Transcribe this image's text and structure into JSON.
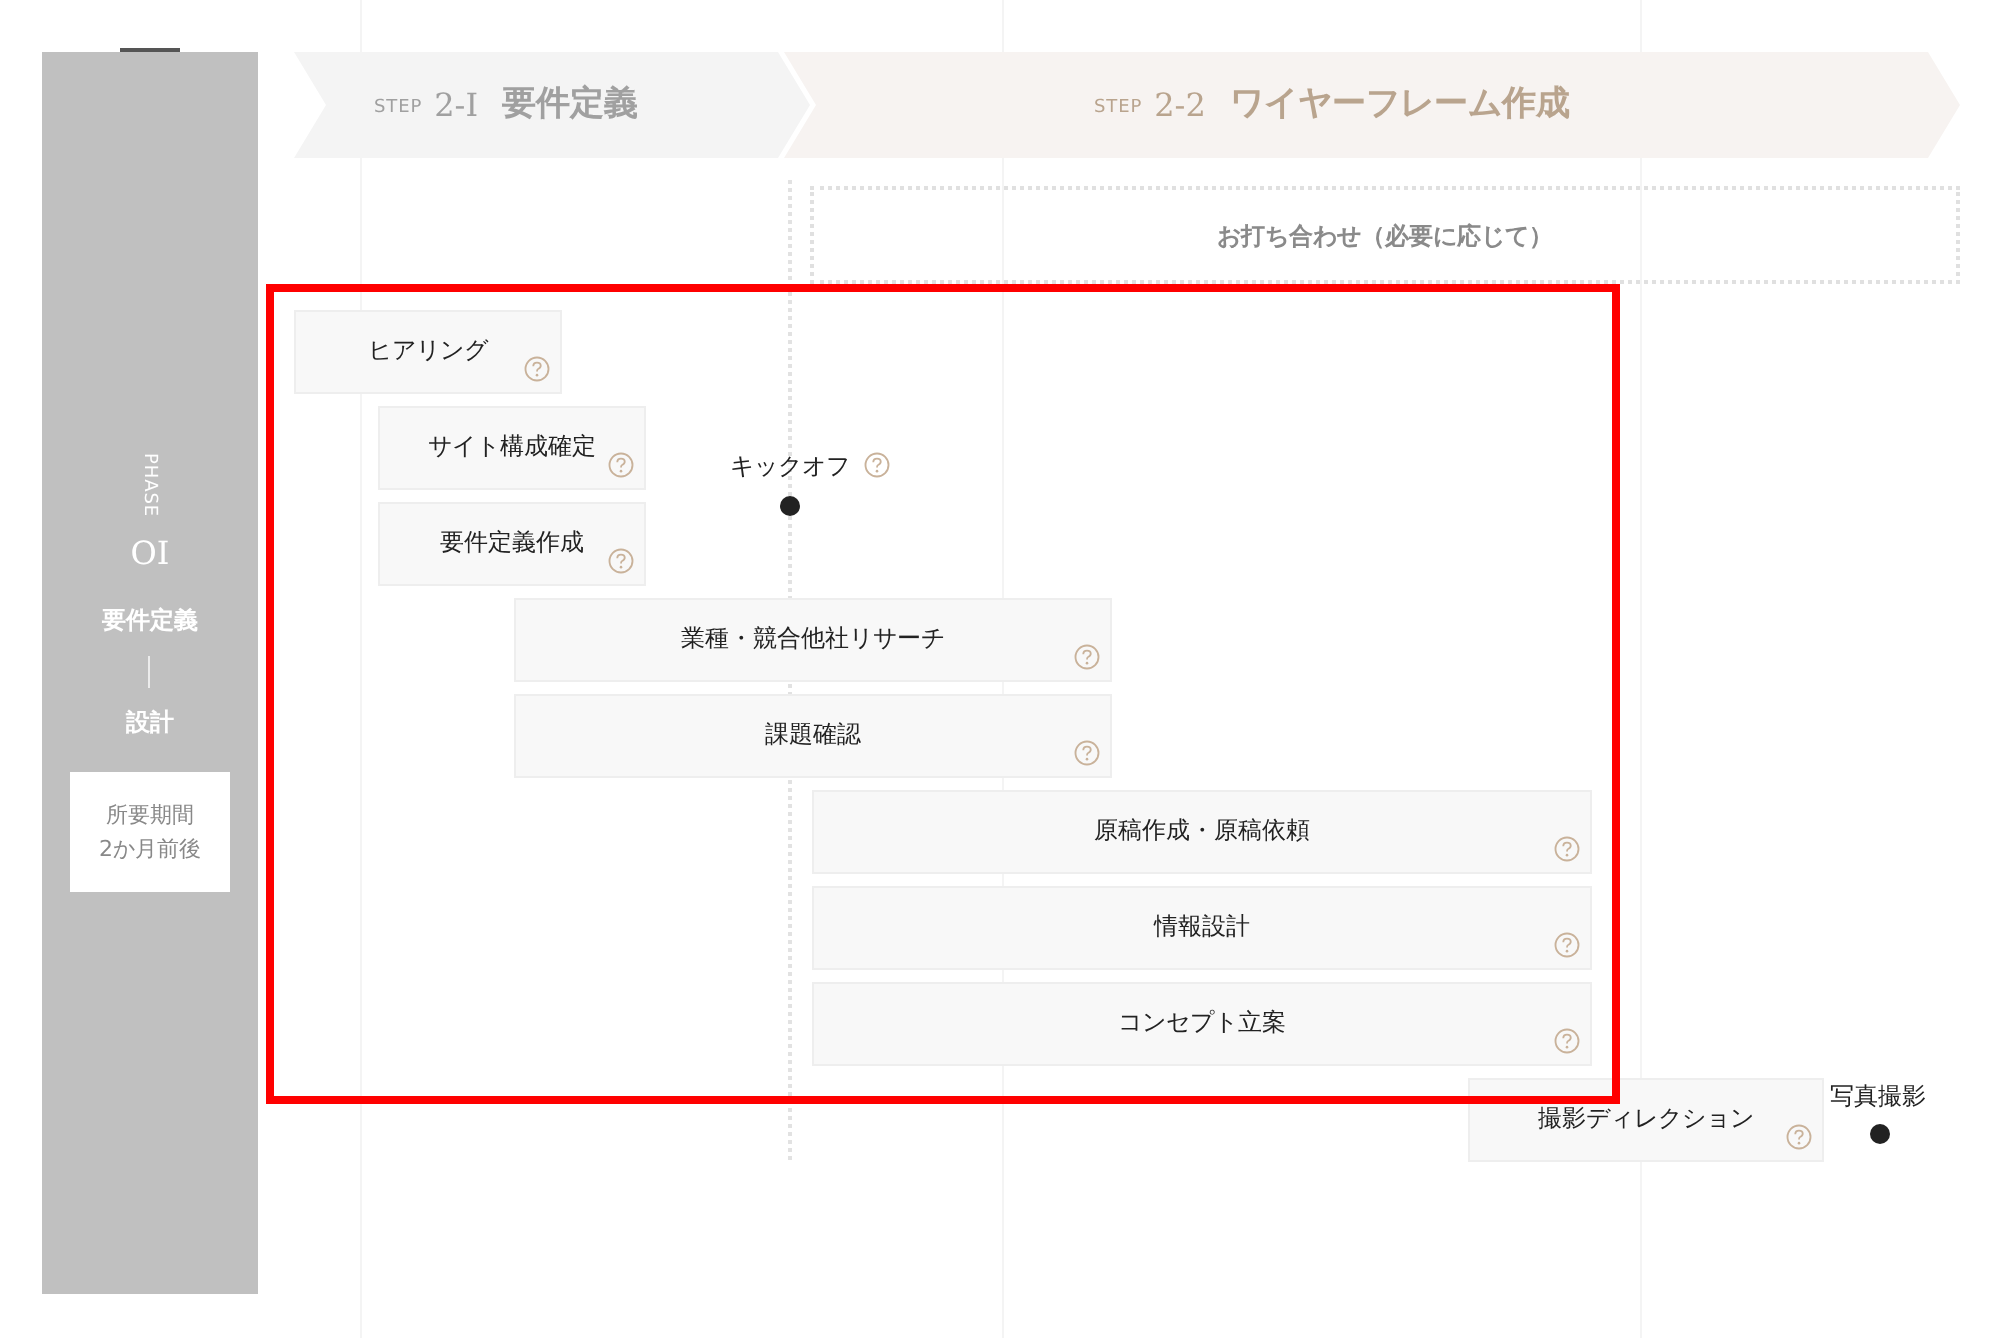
{
  "phase": {
    "label": "PHASE",
    "number": "OI",
    "title": "要件定義",
    "subtitle": "設計",
    "duration": [
      "所要期間",
      "2か月前後"
    ]
  },
  "steps": [
    {
      "prefix": "STEP",
      "number": "2-I",
      "title": "要件定義",
      "selected": false
    },
    {
      "prefix": "STEP",
      "number": "2-2",
      "title": "ワイヤーフレーム作成",
      "selected": true
    }
  ],
  "meeting": {
    "label": "お打ち合わせ（必要に応じて）"
  },
  "milestones": [
    {
      "label": "キックオフ",
      "help": true
    },
    {
      "label": "写真撮影",
      "help": false
    }
  ],
  "tasks": [
    {
      "label": "ヒアリング"
    },
    {
      "label": "サイト構成確定"
    },
    {
      "label": "要件定義作成"
    },
    {
      "label": "業種・競合他社リサーチ"
    },
    {
      "label": "課題確認"
    },
    {
      "label": "原稿作成・原稿依頼"
    },
    {
      "label": "情報設計"
    },
    {
      "label": "コンセプト立案"
    },
    {
      "label": "撮影ディレクション"
    }
  ]
}
